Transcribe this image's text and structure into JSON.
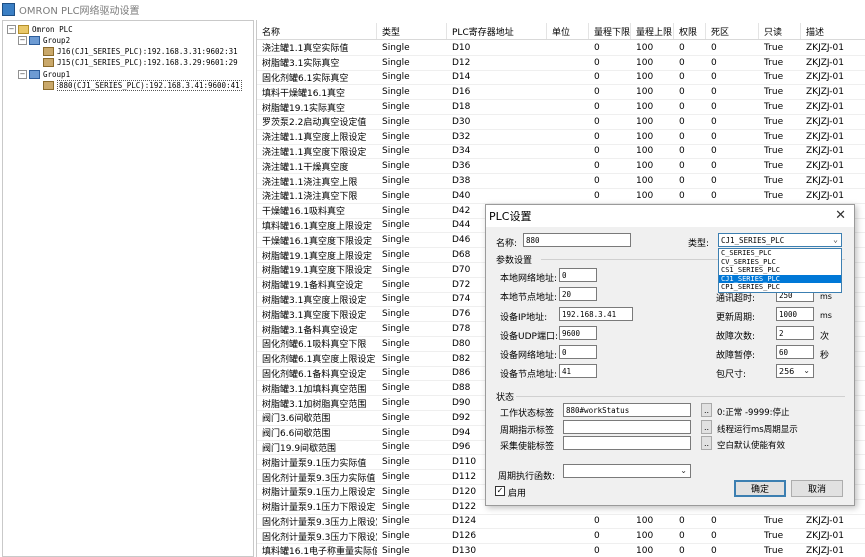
{
  "window": {
    "title": "OMRON PLC网络驱动设置"
  },
  "tree": {
    "root": "Omron PLC",
    "groups": [
      {
        "name": "Group2",
        "items": [
          "J16(CJ1_SERIES_PLC):192.168.3.31:9602:31",
          "J15(CJ1_SERIES_PLC):192.168.3.29:9601:29"
        ]
      },
      {
        "name": "Group1",
        "items": [
          "880(CJ1_SERIES_PLC):192.168.3.41:9600:41"
        ]
      }
    ]
  },
  "grid": {
    "columns": [
      "名称",
      "类型",
      "PLC寄存器地址",
      "单位",
      "量程下限",
      "量程上限",
      "权限",
      "死区",
      "只读",
      "描述"
    ],
    "rows": [
      [
        "浇注罐1.1真空实际值",
        "Single",
        "D10",
        "",
        "0",
        "100",
        "0",
        "0",
        "True",
        "ZKJZJ-01"
      ],
      [
        "树脂罐3.1实际真空",
        "Single",
        "D12",
        "",
        "0",
        "100",
        "0",
        "0",
        "True",
        "ZKJZJ-01"
      ],
      [
        "固化剂罐6.1实际真空",
        "Single",
        "D14",
        "",
        "0",
        "100",
        "0",
        "0",
        "True",
        "ZKJZJ-01"
      ],
      [
        "填料干燥罐16.1真空",
        "Single",
        "D16",
        "",
        "0",
        "100",
        "0",
        "0",
        "True",
        "ZKJZJ-01"
      ],
      [
        "树脂罐19.1实际真空",
        "Single",
        "D18",
        "",
        "0",
        "100",
        "0",
        "0",
        "True",
        "ZKJZJ-01"
      ],
      [
        "罗茨泵2.2启动真空设定值",
        "Single",
        "D30",
        "",
        "0",
        "100",
        "0",
        "0",
        "True",
        "ZKJZJ-01"
      ],
      [
        "浇注罐1.1真空度上限设定",
        "Single",
        "D32",
        "",
        "0",
        "100",
        "0",
        "0",
        "True",
        "ZKJZJ-01"
      ],
      [
        "浇注罐1.1真空度下限设定",
        "Single",
        "D34",
        "",
        "0",
        "100",
        "0",
        "0",
        "True",
        "ZKJZJ-01"
      ],
      [
        "浇注罐1.1干燥真空度",
        "Single",
        "D36",
        "",
        "0",
        "100",
        "0",
        "0",
        "True",
        "ZKJZJ-01"
      ],
      [
        "浇注罐1.1浇注真空上限",
        "Single",
        "D38",
        "",
        "0",
        "100",
        "0",
        "0",
        "True",
        "ZKJZJ-01"
      ],
      [
        "浇注罐1.1浇注真空下限",
        "Single",
        "D40",
        "",
        "0",
        "100",
        "0",
        "0",
        "True",
        "ZKJZJ-01"
      ],
      [
        "干燥罐16.1吸料真空",
        "Single",
        "D42",
        "",
        "",
        "",
        "",
        "",
        "",
        ""
      ],
      [
        "填料罐16.1真空度上限设定",
        "Single",
        "D44",
        "",
        "",
        "",
        "",
        "",
        "",
        ""
      ],
      [
        "干燥罐16.1真空度下限设定",
        "Single",
        "D46",
        "",
        "",
        "",
        "",
        "",
        "",
        ""
      ],
      [
        "树脂罐19.1真空度上限设定",
        "Single",
        "D68",
        "",
        "",
        "",
        "",
        "",
        "",
        ""
      ],
      [
        "树脂罐19.1真空度下限设定",
        "Single",
        "D70",
        "",
        "",
        "",
        "",
        "",
        "",
        ""
      ],
      [
        "树脂罐19.1备料真空设定",
        "Single",
        "D72",
        "",
        "",
        "",
        "",
        "",
        "",
        ""
      ],
      [
        "树脂罐3.1真空度上限设定",
        "Single",
        "D74",
        "",
        "",
        "",
        "",
        "",
        "",
        ""
      ],
      [
        "树脂罐3.1真空度下限设定",
        "Single",
        "D76",
        "",
        "",
        "",
        "",
        "",
        "",
        ""
      ],
      [
        "树脂罐3.1备料真空设定",
        "Single",
        "D78",
        "",
        "",
        "",
        "",
        "",
        "",
        ""
      ],
      [
        "固化剂罐6.1吸料真空下限",
        "Single",
        "D80",
        "",
        "",
        "",
        "",
        "",
        "",
        ""
      ],
      [
        "固化剂罐6.1真空度上限设定",
        "Single",
        "D82",
        "",
        "",
        "",
        "",
        "",
        "",
        ""
      ],
      [
        "固化剂罐6.1备料真空设定",
        "Single",
        "D86",
        "",
        "",
        "",
        "",
        "",
        "",
        ""
      ],
      [
        "树脂罐3.1加填料真空范围",
        "Single",
        "D88",
        "",
        "",
        "",
        "",
        "",
        "",
        ""
      ],
      [
        "树脂罐3.1加树脂真空范围",
        "Single",
        "D90",
        "",
        "",
        "",
        "",
        "",
        "",
        ""
      ],
      [
        "阀门3.6间歇范围",
        "Single",
        "D92",
        "",
        "",
        "",
        "",
        "",
        "",
        ""
      ],
      [
        "阀门6.6间歇范围",
        "Single",
        "D94",
        "",
        "",
        "",
        "",
        "",
        "",
        ""
      ],
      [
        "阀门19.9间歇范围",
        "Single",
        "D96",
        "",
        "",
        "",
        "",
        "",
        "",
        ""
      ],
      [
        "树脂计量泵9.1压力实际值",
        "Single",
        "D110",
        "",
        "",
        "",
        "",
        "",
        "",
        ""
      ],
      [
        "固化剂计量泵9.3压力实际值",
        "Single",
        "D112",
        "",
        "",
        "",
        "",
        "",
        "",
        ""
      ],
      [
        "树脂计量泵9.1压力上限设定",
        "Single",
        "D120",
        "",
        "",
        "",
        "",
        "",
        "",
        ""
      ],
      [
        "树脂计量泵9.1压力下限设定",
        "Single",
        "D122",
        "",
        "",
        "",
        "",
        "",
        "",
        ""
      ],
      [
        "固化剂计量泵9.3压力上限设定",
        "Single",
        "D124",
        "",
        "0",
        "100",
        "0",
        "0",
        "True",
        "ZKJZJ-01"
      ],
      [
        "固化剂计量泵9.3压力下限设定",
        "Single",
        "D126",
        "",
        "0",
        "100",
        "0",
        "0",
        "True",
        "ZKJZJ-01"
      ],
      [
        "填料罐16.1电子称重量实际值",
        "Single",
        "D130",
        "",
        "0",
        "100",
        "0",
        "0",
        "True",
        "ZKJZJ-01"
      ]
    ]
  },
  "dialog": {
    "title": "PLC设置",
    "close": "✕",
    "name_label": "名称:",
    "name_value": "880",
    "type_label": "类型:",
    "type_value": "CJ1_SERIES_PLC",
    "type_options": [
      "C_SERIES_PLC",
      "CV_SERIES_PLC",
      "CS1_SERIES_PLC",
      "CJ1_SERIES_PLC",
      "CP1_SERIES_PLC"
    ],
    "type_selected_index": 3,
    "params_title": "参数设置",
    "local_net_label": "本地网络地址:",
    "local_net_value": "0",
    "local_node_label": "本地节点地址:",
    "local_node_value": "20",
    "ip_label": "设备IP地址:",
    "ip_value": "192.168.3.41",
    "udp_label": "设备UDP端口:",
    "udp_value": "9600",
    "dev_net_label": "设备网络地址:",
    "dev_net_value": "0",
    "dev_node_label": "设备节点地址:",
    "dev_node_value": "41",
    "comm_timeout_label": "通讯超时:",
    "comm_timeout_value": "250",
    "comm_timeout_unit": "ms",
    "update_label": "更新周期:",
    "update_value": "1000",
    "update_unit": "ms",
    "retry_label": "故障次数:",
    "retry_value": "2",
    "retry_unit": "次",
    "pause_label": "故障暂停:",
    "pause_value": "60",
    "pause_unit": "秒",
    "packet_label": "包尺寸:",
    "packet_value": "256",
    "status_title": "状态",
    "work_status_label": "工作状态标签",
    "work_status_value": "880#workStatus",
    "work_status_hint": "0:正常 -9999:停止",
    "cycle_label": "周期指示标签",
    "cycle_value": "",
    "cycle_hint": "线程运行ms周期显示",
    "collect_label": "采集使能标签",
    "collect_value": "",
    "collect_hint": "空白默认使能有效",
    "dots": "..",
    "func_label": "周期执行函数:",
    "func_value": "",
    "enable_label": "启用",
    "enable_checked": "✓",
    "ok": "确定",
    "cancel": "取消"
  }
}
